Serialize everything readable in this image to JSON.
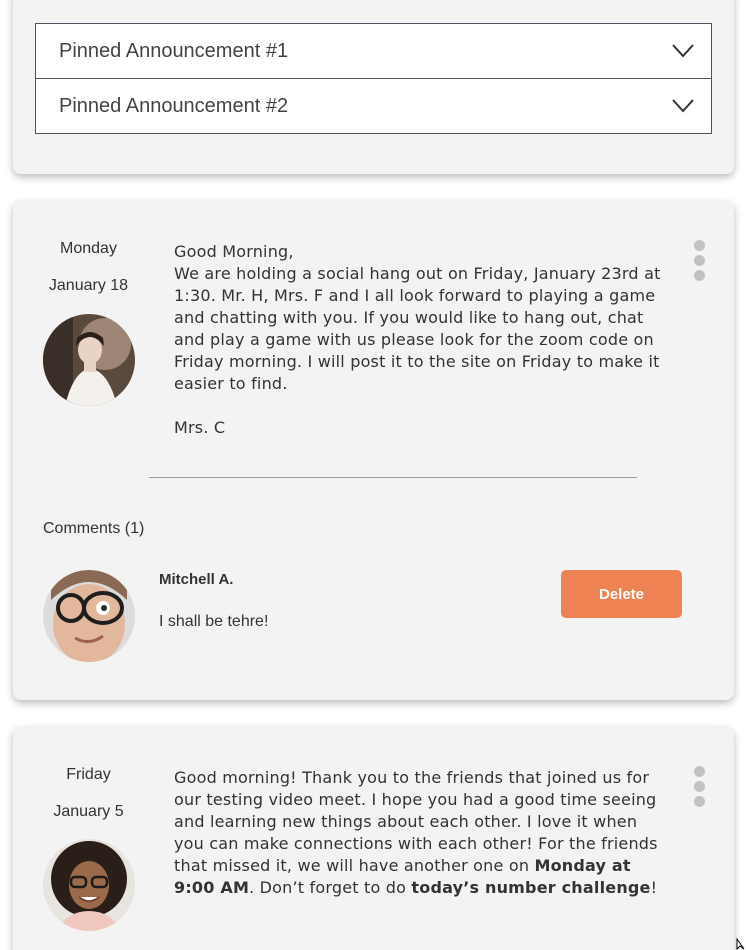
{
  "pinned": [
    {
      "label": "Pinned Announcement #1"
    },
    {
      "label": "Pinned Announcement #2"
    }
  ],
  "post1": {
    "day": "Monday",
    "date": "January 18",
    "greeting": "Good Morning,",
    "body": "We are holding a social hang out on Friday, January 23rd at 1:30.  Mr. H, Mrs. F and I all look forward to playing a game and chatting with you.  If you would like to hang out, chat and play a game with us please look for the zoom code on Friday morning.  I will post it to the site on Friday to make it easier to find.",
    "signature": "Mrs. C",
    "comments_heading": "Comments (1)",
    "comment": {
      "author": "Mitchell A.",
      "text": "I shall be tehre!",
      "delete_label": "Delete"
    }
  },
  "post2": {
    "day": "Friday",
    "date": "January 5",
    "text_part1": "Good morning! Thank you to the friends that joined us for our testing video meet. I hope you had a good time seeing and learning new things about each other. I love it when you can make connections with each other! For the friends that missed it, we will have another one on ",
    "bold1": "Monday at 9:00 AM",
    "text_part2": ". Don’t forget to do ",
    "bold2": "today’s number challenge",
    "text_part3": "!"
  },
  "colors": {
    "card_bg": "#f3f3f3",
    "delete_button": "#ef8253",
    "menu_dots": "#c2c2c2"
  }
}
